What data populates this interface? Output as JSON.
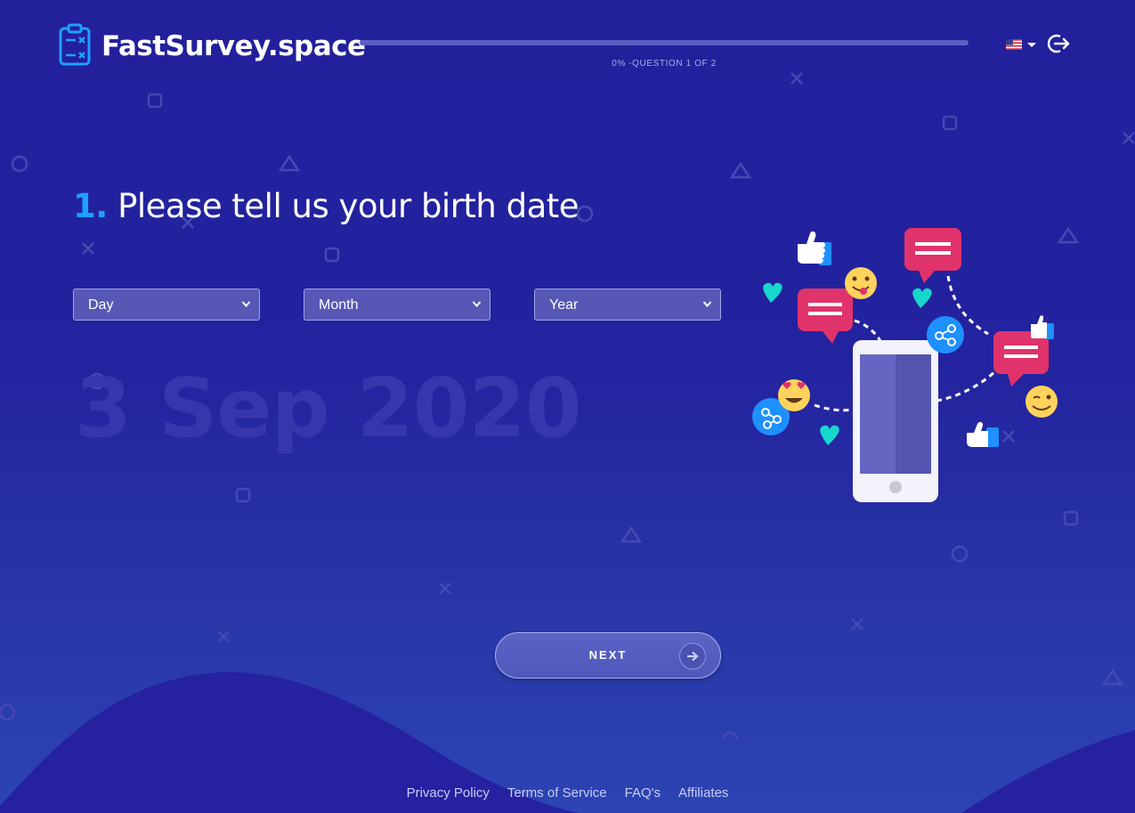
{
  "header": {
    "brand": "FastSurvey.space",
    "progress_percent": 0,
    "progress_label": "0% -QUESTION 1 OF 2",
    "language_icon": "us-flag-icon",
    "logout_icon": "logout-icon"
  },
  "question": {
    "number": "1.",
    "text": "Please tell us your birth date"
  },
  "selects": {
    "day": "Day",
    "month": "Month",
    "year": "Year"
  },
  "date_preview": "3 Sep 2020",
  "next_button": {
    "label": "NEXT",
    "icon": "arrow-right-icon"
  },
  "footer": {
    "links": [
      "Privacy Policy",
      "Terms of Service",
      "FAQ's",
      "Affiliates"
    ]
  },
  "colors": {
    "background": "#23209c",
    "accent": "#1ea0ff",
    "chat_bubble": "#e0336b",
    "share_button": "#1e90ff",
    "heart": "#17d7cc"
  }
}
